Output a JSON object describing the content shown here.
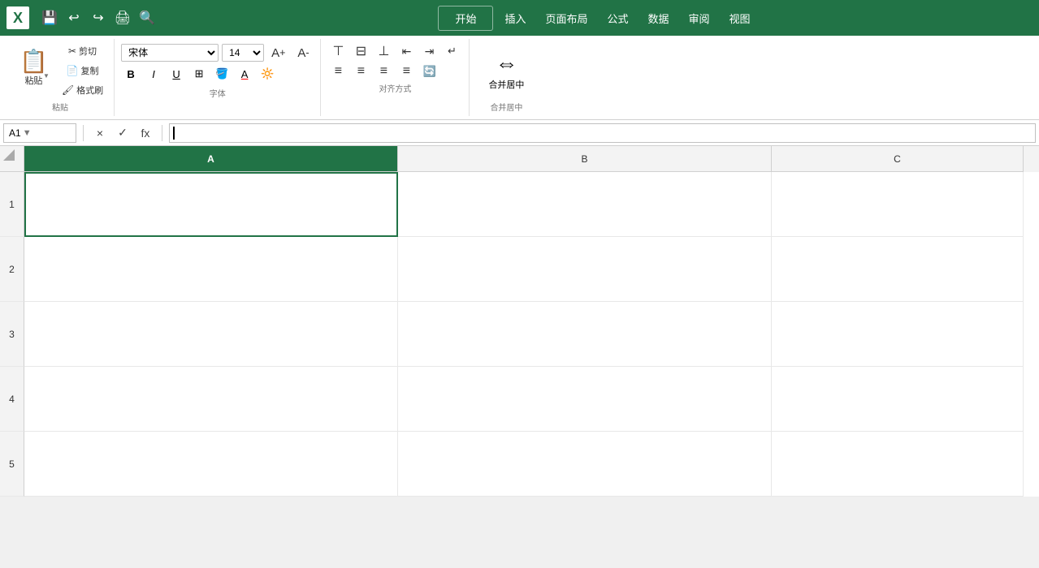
{
  "titlebar": {
    "app_icon": "X",
    "quick_buttons": [
      "💾",
      "↩",
      "↪",
      "🖨",
      "🔍"
    ],
    "undo_label": "↩",
    "redo_label": "↪",
    "save_label": "💾",
    "print_label": "🖨",
    "zoom_label": "🔍",
    "start_btn": "开始",
    "nav_items": [
      "插入",
      "页面布局",
      "公式",
      "数据",
      "审阅",
      "视图"
    ]
  },
  "ribbon": {
    "active_tab": "开始",
    "tabs": [
      "开始",
      "插入",
      "页面布局",
      "公式",
      "数据",
      "审阅",
      "视图"
    ],
    "clipboard": {
      "label": "粘贴",
      "paste_label": "粘贴",
      "cut_label": "剪切",
      "copy_label": "复制",
      "format_label": "格式刷",
      "icon_paste": "📋",
      "icon_cut": "✂",
      "icon_copy": "📄",
      "icon_format": "🖌"
    },
    "font": {
      "label": "字体",
      "font_name": "宋体",
      "font_size": "14",
      "grow_label": "A⁺",
      "shrink_label": "A⁻",
      "bold_label": "B",
      "italic_label": "I",
      "underline_label": "U",
      "border_label": "⊞",
      "fill_label": "🪣",
      "color_label": "A"
    },
    "alignment": {
      "label": "对齐方式",
      "top_label": "⊤",
      "middle_label": "⊟",
      "bottom_label": "⊥",
      "left_label": "≡",
      "center_label": "≡",
      "right_label": "≡",
      "indent_dec": "⇤",
      "indent_inc": "⇥",
      "wrap_label": "↵",
      "merge_label": "合并居中"
    }
  },
  "formula_bar": {
    "cell_ref": "A1",
    "cancel_label": "×",
    "confirm_label": "✓",
    "fx_label": "fx"
  },
  "spreadsheet": {
    "columns": [
      "A",
      "B",
      "C"
    ],
    "rows": [
      "1",
      "2",
      "3",
      "4",
      "5"
    ],
    "selected_cell": "A1",
    "selected_col": "A"
  },
  "colors": {
    "accent": "#217346",
    "selected_border": "#217346",
    "header_bg": "#f3f3f3"
  }
}
